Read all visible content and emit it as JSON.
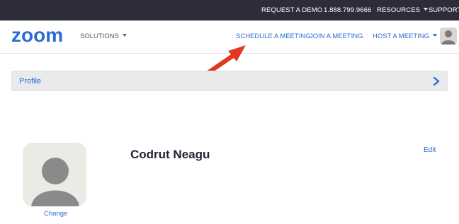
{
  "topbar": {
    "request_demo": "REQUEST A DEMO",
    "phone": "1.888.799.9666",
    "resources": "RESOURCES",
    "support": "SUPPORT"
  },
  "navbar": {
    "logo_text": "zoom",
    "solutions": "SOLUTIONS",
    "schedule": "SCHEDULE A MEETING",
    "join": "JOIN A MEETING",
    "host": "HOST A MEETING"
  },
  "profile_bar": {
    "label": "Profile"
  },
  "profile": {
    "name": "Codrut Neagu",
    "change_label": "Change",
    "edit_label": "Edit"
  },
  "colors": {
    "topbar_bg": "#2d2d3a",
    "brand_blue": "#2d6bd2",
    "arrow_red": "#e0391f"
  },
  "icons": {
    "nav_avatar": "user-avatar-icon",
    "profile_avatar": "user-avatar-icon",
    "profile_chevron": "chevron-right-icon",
    "dropdown": "caret-down-icon"
  }
}
